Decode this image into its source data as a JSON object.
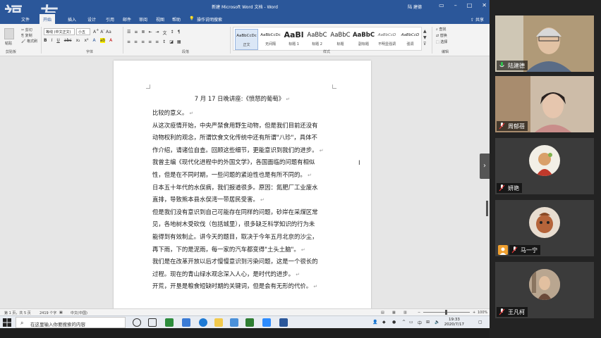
{
  "word": {
    "watermark": "福 友",
    "title": "新建 Microsoft Word 文档 - Word",
    "user": "陆 建德",
    "menu_tabs": [
      "文件",
      "开始",
      "插入",
      "设计",
      "布局",
      "引用",
      "邮件",
      "审阅",
      "视图",
      "帮助",
      "操作说明搜索"
    ],
    "share_label": "共享",
    "ribbon": {
      "clipboard": {
        "paste": "粘贴",
        "cut": "剪切",
        "copy": "复制",
        "format_painter": "格式刷",
        "group": "剪贴板"
      },
      "font": {
        "name": "等线 (中文正文)",
        "size": "小五",
        "group": "字体"
      },
      "paragraph_group": "段落",
      "styles_group": "样式",
      "editing_group": "编辑",
      "styles": [
        {
          "preview": "AaBbCcDc",
          "name": "正文"
        },
        {
          "preview": "AaBbCcDc",
          "name": "无间隔"
        },
        {
          "preview": "AaBl",
          "name": "标题 1"
        },
        {
          "preview": "AaBbC",
          "name": "标题 2"
        },
        {
          "preview": "AaBbC",
          "name": "标题"
        },
        {
          "preview": "AaBbC",
          "name": "副标题"
        },
        {
          "preview": "AaBbCcD",
          "name": "不明显强调"
        },
        {
          "preview": "AaBbCcD",
          "name": "强调"
        }
      ],
      "editing": {
        "find": "查找",
        "replace": "替换",
        "select": "选择"
      }
    },
    "document": {
      "heading": "7 月 17 日晚讲座:《愤怒的葡萄》",
      "lines": [
        "比较的意义。",
        "从这次疫情开始，中央严禁食用野生动物，但是我们目前还没有",
        "动物权利的观念，所谓饮食文化传统中还有所谓\"八珍\"，具体不",
        "作介绍，请诸位自查。回顾这些细节，更能意识到我们的进步。",
        "我曾主编《现代化进程中的外国文学》，各国面临的问题有相似",
        "性，但是在不同时期，一些问题的紧迫性也是有所不同的。",
        "日本五十年代的水俣病，我们报道很多。原因：氮肥厂工业废水",
        "直排，导致熊本县水俣湾一带居民受害。",
        "但是我们没有意识到自己可能存在同样的问题，砂岸在采煤区常",
        "见，各地树木受砍伐（包括城里），很多缺乏科学知识的行为未",
        "能得到有效制止。讲今天的题目，取决于今年五月北京的沙尘，",
        "再下雨，下的是泥雨，每一家的汽车都变得\"土头土脑\"。",
        "我们是在改革开放以后才慢慢意识到污染问题，这是一个很长的",
        "过程。现在的青山绿水观念深入人心，是时代的进步。",
        "开荒，开垦是粮食短缺时期的关键词，但是会有无形的代价。"
      ],
      "paragraph_ends": [
        0,
        3,
        5,
        7,
        11,
        13,
        14
      ]
    },
    "status": {
      "page": "第 1 页，共 5 页",
      "words": "2419 个字",
      "lang": "中文(中国)",
      "zoom": "100%"
    },
    "taskbar": {
      "search_placeholder": "在这里输入你要搜索的内容",
      "time": "19:33",
      "date": "2020/7/17",
      "ime": "中"
    }
  },
  "participants": [
    {
      "name": "陆建德",
      "mic": "on"
    },
    {
      "name": "周郁蓓",
      "mic": "off"
    },
    {
      "name": "妍艳",
      "mic": "off"
    },
    {
      "name": "马一宁",
      "mic": "off"
    },
    {
      "name": "王凡柯",
      "mic": "off"
    }
  ]
}
